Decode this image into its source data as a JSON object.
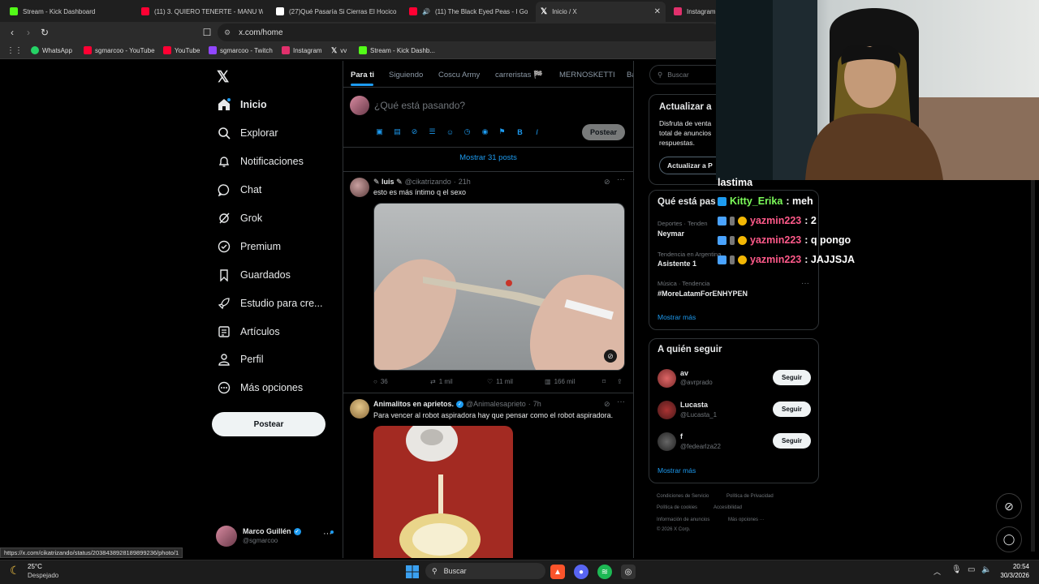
{
  "browser": {
    "tabs": [
      {
        "label": "Stream - Kick Dashboard",
        "color": "#53fc18"
      },
      {
        "label": "(11) 3. QUIERO TENERTE - MANU W",
        "color": "#ff0033"
      },
      {
        "label": "(27)Qué Pasaría Si Cierras El Hocico",
        "color": "#ffffff"
      },
      {
        "label": "(11) The Black Eyed Peas - I Gotta",
        "color": "#ff0033"
      },
      {
        "label": "Inicio / X",
        "color": "#ffffff"
      },
      {
        "label": "Instagram",
        "color": "#e1306c"
      }
    ],
    "url": "x.com/home",
    "bookmarks": [
      {
        "label": "WhatsApp",
        "color": "#25d366"
      },
      {
        "label": "sgmarcoo - YouTube",
        "color": "#ff0033"
      },
      {
        "label": "YouTube",
        "color": "#ff0033"
      },
      {
        "label": "sgmarcoo - Twitch",
        "color": "#9146ff"
      },
      {
        "label": "Instagram",
        "color": "#e1306c"
      },
      {
        "label": "vv",
        "color": "#ffffff"
      },
      {
        "label": "Stream - Kick Dashb...",
        "color": "#53fc18"
      }
    ],
    "status_url": "https://x.com/cikatrizando/status/2038438928189899236/photo/1"
  },
  "nav": {
    "items": [
      {
        "label": "Inicio",
        "icon": "home-icon"
      },
      {
        "label": "Explorar",
        "icon": "search-icon"
      },
      {
        "label": "Notificaciones",
        "icon": "bell-icon"
      },
      {
        "label": "Chat",
        "icon": "chat-icon"
      },
      {
        "label": "Grok",
        "icon": "grok-icon"
      },
      {
        "label": "Premium",
        "icon": "premium-icon"
      },
      {
        "label": "Guardados",
        "icon": "bookmark-icon"
      },
      {
        "label": "Estudio para cre...",
        "icon": "rocket-icon"
      },
      {
        "label": "Artículos",
        "icon": "articles-icon"
      },
      {
        "label": "Perfil",
        "icon": "person-icon"
      },
      {
        "label": "Más opciones",
        "icon": "more-icon"
      }
    ],
    "post_button": "Postear",
    "account": {
      "name": "Marco Guillén",
      "handle": "@sgmarcoo"
    }
  },
  "feed": {
    "tabs": [
      "Para ti",
      "Siguiendo",
      "Coscu Army",
      "carreristas 🏁",
      "MERNOSKETTI",
      "Ba"
    ],
    "composer_placeholder": "¿Qué está pasando?",
    "composer_post": "Postear",
    "show_more": "Mostrar 31 posts",
    "posts": [
      {
        "name": "luis",
        "handle": "@cikatrizando",
        "time": "21h",
        "text": "esto es más íntimo q el sexo",
        "replies": "36",
        "reposts": "1 mil",
        "likes": "11 mil",
        "views": "166 mil"
      },
      {
        "name": "Animalitos en aprietos.",
        "handle": "@Animalesaprieto",
        "time": "7h",
        "text": "Para vencer al robot aspiradora hay que pensar como el robot aspiradora."
      }
    ]
  },
  "sidebar": {
    "search_placeholder": "Buscar",
    "premium": {
      "title": "Actualizar a",
      "text_lines": [
        "Disfruta de venta",
        "total de anuncios",
        "respuestas."
      ],
      "button": "Actualizar a P"
    },
    "trends": {
      "title": "Qué está pas",
      "items": [
        {
          "category": "Deportes · Tenden",
          "name": "Neymar"
        },
        {
          "category": "Tendencia en Argentina",
          "name": "Asistente 1"
        },
        {
          "category": "Música · Tendencia",
          "name": "#MoreLatamForENHYPEN"
        }
      ],
      "show_more": "Mostrar más"
    },
    "who_to_follow": {
      "title": "A quién seguir",
      "users": [
        {
          "name": "av",
          "handle": "@avrprado",
          "button": "Seguir"
        },
        {
          "name": "Lucasta",
          "handle": "@Lucasta_1",
          "button": "Seguir"
        },
        {
          "name": "f",
          "handle": "@fedearlza22",
          "button": "Seguir"
        }
      ],
      "show_more": "Mostrar más"
    },
    "footer": [
      "Condiciones de Servicio",
      "Política de Privacidad",
      "Política de cookies",
      "Accesibilidad",
      "Información de anuncios",
      "Más opciones ···",
      "© 2026 X Corp."
    ]
  },
  "chat_overlay": {
    "header": "lastima",
    "messages": [
      {
        "user": "Kitty_Erika",
        "text": ": meh",
        "color": "#7cfc5a"
      },
      {
        "user": "yazmin223",
        "text": ": 2",
        "color": "#ff5a8a"
      },
      {
        "user": "yazmin223",
        "text": ": q pongo",
        "color": "#ff5a8a"
      },
      {
        "user": "yazmin223",
        "text": ": JAJJSJA",
        "color": "#ff5a8a"
      }
    ]
  },
  "taskbar": {
    "weather_temp": "25°C",
    "weather_desc": "Despejado",
    "search": "Buscar",
    "time": "20:54",
    "date": "30/3/2026"
  }
}
